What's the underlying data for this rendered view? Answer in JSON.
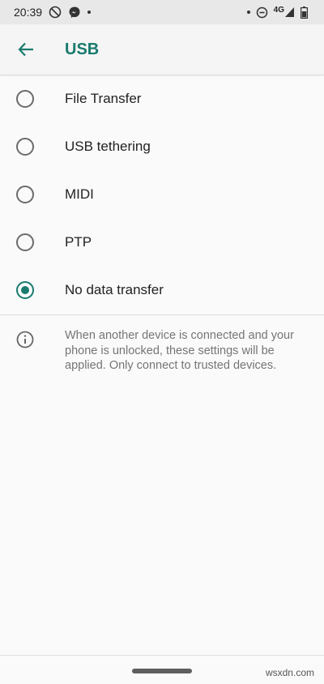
{
  "status_bar": {
    "time": "20:39",
    "network": "4G"
  },
  "app_bar": {
    "title": "USB",
    "back_icon": "arrow-left-icon"
  },
  "options": [
    {
      "label": "File Transfer",
      "selected": false
    },
    {
      "label": "USB tethering",
      "selected": false
    },
    {
      "label": "MIDI",
      "selected": false
    },
    {
      "label": "PTP",
      "selected": false
    },
    {
      "label": "No data transfer",
      "selected": true
    }
  ],
  "info": {
    "icon": "info-icon",
    "text": "When another device is connected and your phone is unlocked, these settings will be applied. Only connect to trusted devices."
  },
  "watermark": "wsxdn.com",
  "colors": {
    "accent": "#1a7a6e",
    "status_bar_bg": "#e8e8e8",
    "background": "#fafafa"
  }
}
